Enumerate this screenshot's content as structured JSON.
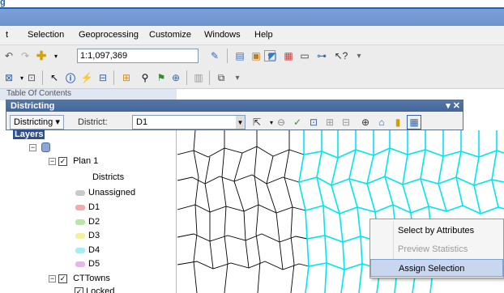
{
  "banner": {
    "text": "g"
  },
  "menu": [
    "t",
    "Selection",
    "Geoprocessing",
    "Customize",
    "Windows",
    "Help"
  ],
  "toolbar": {
    "scale": "1:1,097,369"
  },
  "toc": {
    "title": "Table Of Contents"
  },
  "districting": {
    "title": "Districting",
    "menu_label": "Districting ▾",
    "district_label": "District:",
    "district_value": "D1"
  },
  "layers": {
    "root_label": "Layers",
    "plan_label": "Plan 1",
    "districts_header": "Districts",
    "districts": [
      {
        "label": "Unassigned",
        "color": "#c9c9c9"
      },
      {
        "label": "D1",
        "color": "#f7a8a8"
      },
      {
        "label": "D2",
        "color": "#b6e6a4"
      },
      {
        "label": "D3",
        "color": "#f5f0a0"
      },
      {
        "label": "D4",
        "color": "#a8eef0"
      },
      {
        "label": "D5",
        "color": "#e7b4ef"
      }
    ],
    "towns_label": "CTTowns",
    "locked_label": "Locked"
  },
  "context_menu": {
    "items": [
      {
        "label": "Select by Attributes",
        "enabled": true
      },
      {
        "label": "Preview Statistics",
        "enabled": false
      },
      {
        "label": "Assign Selection",
        "enabled": true,
        "highlighted": true
      }
    ]
  },
  "colors": {
    "selection": "#00e5ee",
    "title_bar": "#6f93cf",
    "districting_header": "#4a6ea3"
  }
}
